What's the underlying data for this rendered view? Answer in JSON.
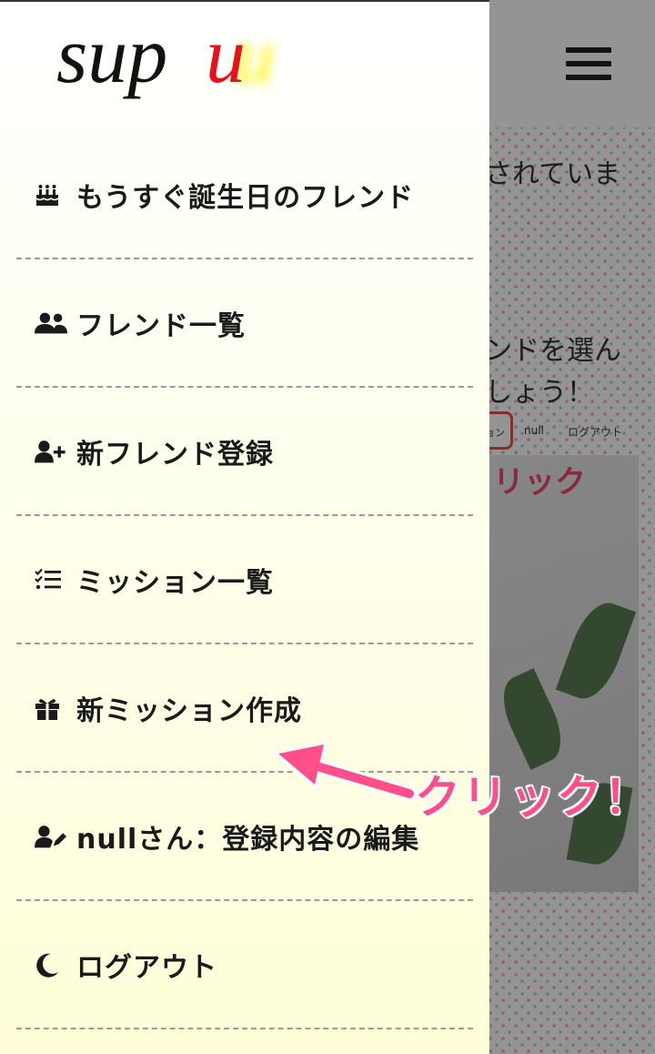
{
  "background": {
    "line1": "されていま",
    "line2": "ンドを選ん",
    "line3": "しょう！",
    "menu_mission": "ョン",
    "menu_null": "null",
    "menu_logout": "ログアウト",
    "click_small": "リック"
  },
  "logo": {
    "prefix": "sup",
    "highlight": "u"
  },
  "menu": {
    "items": [
      {
        "icon": "birthday-cake-icon",
        "label": "もうすぐ誕生日のフレンド"
      },
      {
        "icon": "users-icon",
        "label": "フレンド一覧"
      },
      {
        "icon": "user-plus-icon",
        "label": "新フレンド登録"
      },
      {
        "icon": "tasks-icon",
        "label": "ミッション一覧"
      },
      {
        "icon": "gift-icon",
        "label": "新ミッション作成"
      },
      {
        "icon": "user-edit-icon",
        "label": "nullさん：登録内容の編集"
      },
      {
        "icon": "moon-icon",
        "label": "ログアウト"
      }
    ]
  },
  "annotation": {
    "text": "クリック！",
    "color": "#ff4f8b"
  },
  "colors": {
    "accent": "#ff4f8b",
    "logo_red": "#e8101a",
    "logo_glow": "#fff200"
  }
}
